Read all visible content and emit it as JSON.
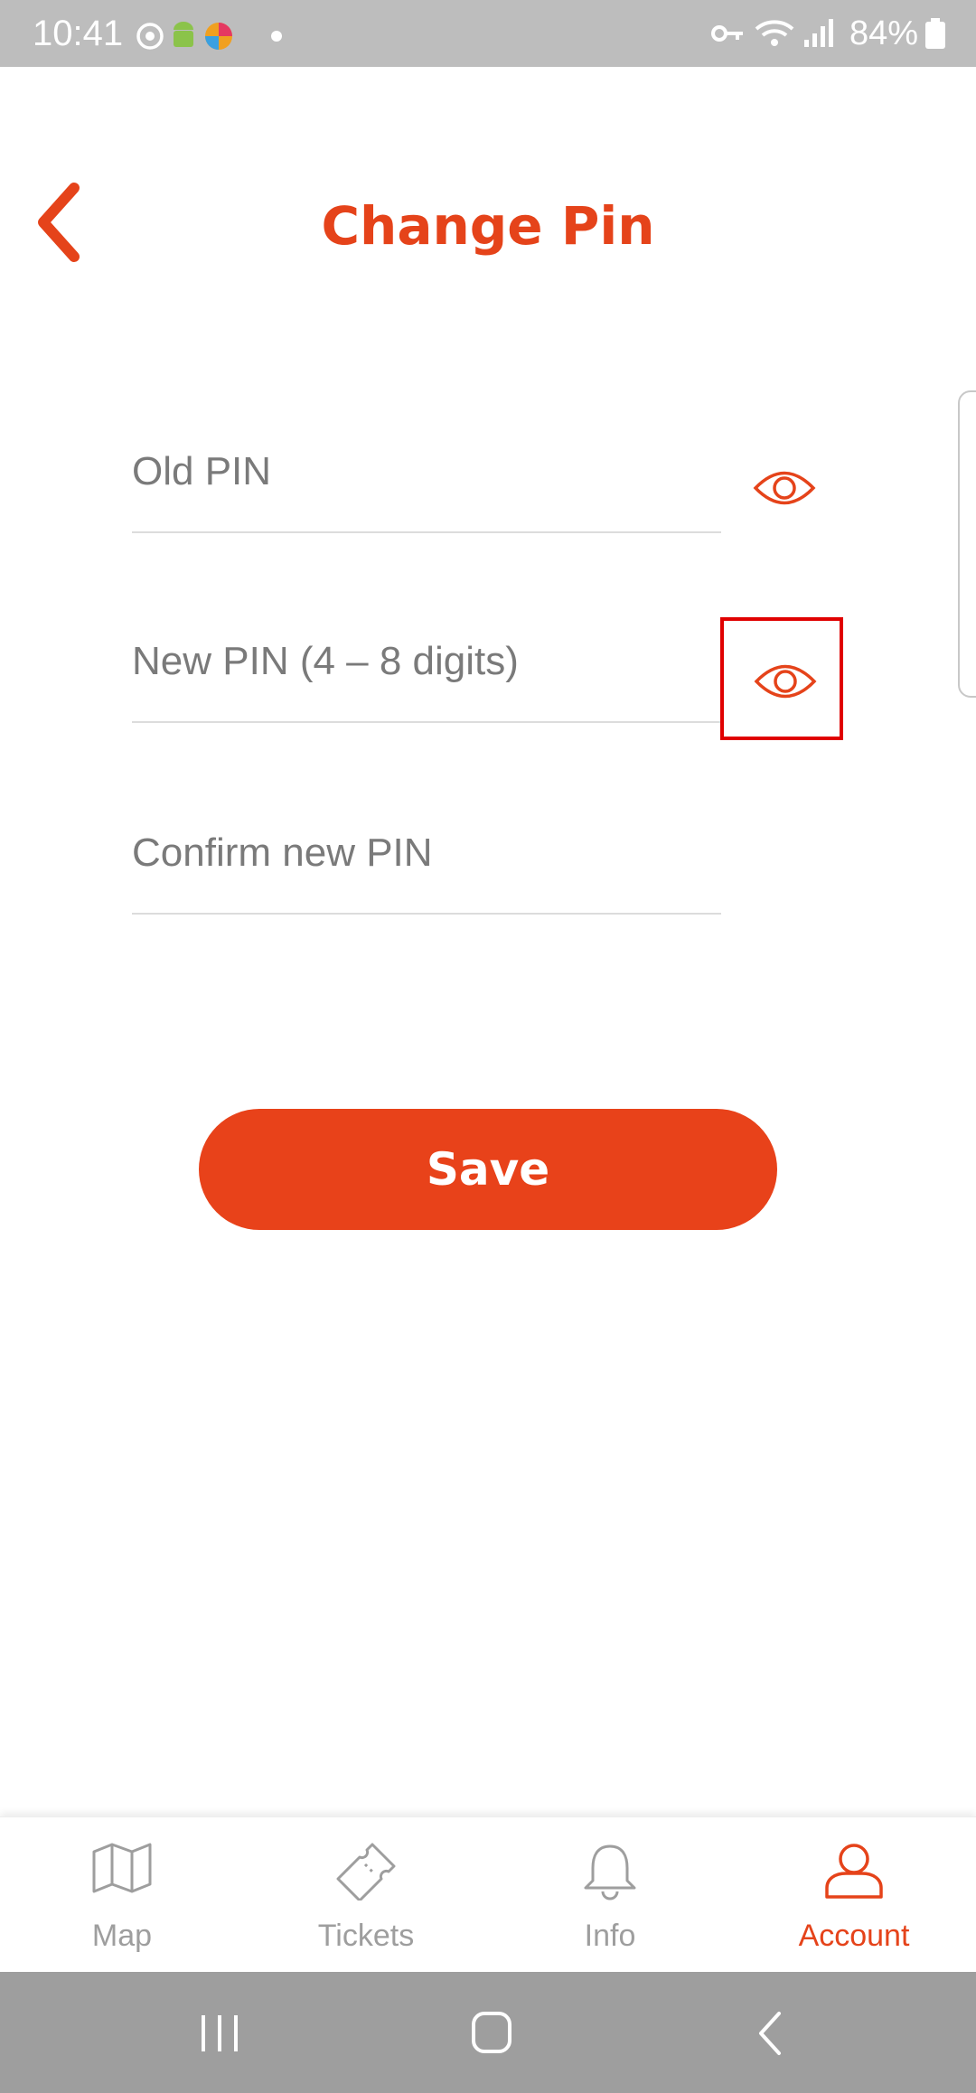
{
  "status_bar": {
    "time": "10:41",
    "battery": "84%",
    "left_icons": [
      "sync-icon",
      "android-icon",
      "app-icon",
      "dot-icon"
    ],
    "right_icons": [
      "vpn-key-icon",
      "wifi-icon",
      "signal-icon",
      "battery-icon"
    ]
  },
  "header": {
    "title": "Change Pin",
    "accent_color": "#e5431a"
  },
  "form": {
    "old_pin": {
      "placeholder": "Old PIN",
      "value": ""
    },
    "new_pin": {
      "placeholder": "New PIN (4 – 8 digits)",
      "value": ""
    },
    "confirm_pin": {
      "placeholder": "Confirm new PIN",
      "value": ""
    }
  },
  "actions": {
    "save_label": "Save",
    "save_color": "#e8421a"
  },
  "bottom_nav": {
    "items": [
      {
        "label": "Map",
        "icon": "map-icon",
        "active": false
      },
      {
        "label": "Tickets",
        "icon": "ticket-icon",
        "active": false
      },
      {
        "label": "Info",
        "icon": "bell-icon",
        "active": false
      },
      {
        "label": "Account",
        "icon": "person-icon",
        "active": true
      }
    ]
  },
  "system_nav": {
    "buttons": [
      "recents-icon",
      "home-icon",
      "back-icon"
    ]
  }
}
